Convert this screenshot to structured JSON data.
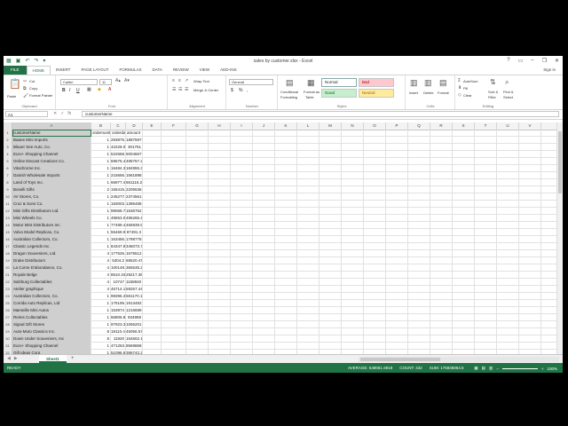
{
  "titlebar": {
    "title": "sales by customer.xlsx - Excel"
  },
  "tabs": [
    "FILE",
    "HOME",
    "INSERT",
    "PAGE LAYOUT",
    "FORMULAS",
    "DATA",
    "REVIEW",
    "VIEW",
    "ADD-INS"
  ],
  "account": {
    "signin": "Sign in"
  },
  "ribbon": {
    "clipboard": {
      "paste": "Paste",
      "cut": "Cut",
      "copy": "Copy",
      "format_painter": "Format Painter",
      "label": "Clipboard"
    },
    "font": {
      "name": "Calibri",
      "size": "11",
      "bold": "B",
      "italic": "I",
      "underline": "U",
      "label": "Font"
    },
    "alignment": {
      "wrap": "Wrap Text",
      "merge": "Merge & Center",
      "label": "Alignment"
    },
    "number": {
      "format": "General",
      "currency": "$",
      "percent": "%",
      "comma": ",",
      "label": "Number"
    },
    "styles": {
      "conditional": "Conditional",
      "conditional2": "Formatting",
      "format_as": "Format as",
      "format_as2": "Table",
      "normal": "Normal",
      "bad": "Bad",
      "good": "Good",
      "neutral": "Neutral",
      "label": "Styles"
    },
    "cells": {
      "insert": "Insert",
      "delete": "Delete",
      "format": "Format",
      "label": "Cells"
    },
    "editing": {
      "autosum": "AutoSum",
      "fill": "Fill",
      "clear": "Clear",
      "sort": "Sort &",
      "sort2": "Filter",
      "find": "Find &",
      "find2": "Select",
      "label": "Editing"
    }
  },
  "formula_bar": {
    "name_box": "A1",
    "value": "customerName"
  },
  "columns": [
    "A",
    "B",
    "C",
    "D",
    "E",
    "F",
    "G",
    "H",
    "I",
    "J",
    "K",
    "L",
    "M",
    "N",
    "O",
    "P",
    "Q",
    "R",
    "S",
    "T",
    "U",
    "V"
  ],
  "header_row": [
    "customerName",
    "ordernumber",
    "orderdate",
    "amount"
  ],
  "rows": [
    [
      "Baane Mini Imports",
      "1",
      "293875.6",
      "1887597"
    ],
    [
      "Blauer See Auto, Co.",
      "1",
      "42228.04",
      "301761"
    ],
    [
      "Euro+ Shopping Channel",
      "1",
      "522668.6",
      "5004667"
    ],
    [
      "Online Diecast Creations Co.",
      "1",
      "69675.45",
      "485757.2"
    ],
    [
      "Vitachrome Inc.",
      "1",
      "16484.34",
      "184955.3"
    ],
    [
      "Danish Wholesale Imports",
      "1",
      "215656.8",
      "1561898"
    ],
    [
      "Land of Toys Inc.",
      "1",
      "66977.46",
      "661115.2"
    ],
    [
      "Boselli Gifts",
      "2",
      "155415.6",
      "2205536"
    ],
    [
      "AV Stores, Co.",
      "1",
      "245277.1",
      "2374561"
    ],
    [
      "Cruz & Sons Co.",
      "1",
      "183003.7",
      "1395485"
    ],
    [
      "Mini Gifts Distributors Ltd.",
      "1",
      "99068.7",
      "1536752"
    ],
    [
      "Mini Wheels Co.",
      "1",
      "49653.05",
      "495265.4"
    ],
    [
      "Motor Mint Distributors Inc.",
      "1",
      "77489.42",
      "466939.5"
    ],
    [
      "Volvo Model Replicas, Co.",
      "1",
      "55469.96",
      "87491.3"
    ],
    [
      "Australian Collectors, Co.",
      "1",
      "163456.1",
      "1798776"
    ],
    [
      "Classic Legends Inc.",
      "1",
      "84347.94",
      "346073.7"
    ],
    [
      "Dragon Souveniers, Ltd.",
      "4",
      "177526.0",
      "1675512"
    ],
    [
      "Drake Distributors",
      "4",
      "5304.2",
      "68520.47"
    ],
    [
      "La Corne D'abondance, Co.",
      "4",
      "100149.4",
      "365535.2"
    ],
    [
      "Royale Belge",
      "4",
      "8510.34",
      "29217.36"
    ],
    [
      "Salzburg Collectables",
      "4",
      "10747",
      "1158840"
    ],
    [
      "Atelier graphique",
      "4",
      "45714.12",
      "59257.44"
    ],
    [
      "Australian Collectors, Co.",
      "1",
      "98396.32",
      "581170.1"
    ],
    [
      "Corrida Auto Replicas, Ltd",
      "1",
      "175195.6",
      "1913482"
    ],
    [
      "Marseille Mini Autos",
      "1",
      "153974",
      "1216689"
    ],
    [
      "Reims Collectables",
      "1",
      "66805.86",
      "934959"
    ],
    [
      "Signal Gift Stores",
      "1",
      "97923.34",
      "1065201"
    ],
    [
      "Auto-Moto Classics Inc.",
      "8",
      "18110.46",
      "45056.57"
    ],
    [
      "Down Under Souveniers, Inc",
      "8",
      "11920",
      "154602.1"
    ],
    [
      "Euro+ Shopping Channel",
      "1",
      "471263.4",
      "8569868"
    ],
    [
      "Gift Ideas Corp.",
      "1",
      "51096.97",
      "395742.2"
    ]
  ],
  "sheet": {
    "name": "Sheet1",
    "add": "+"
  },
  "status": {
    "ready": "READY",
    "average": "AVERAGE: 548061.6919",
    "count": "COUNT: 432",
    "sum": "SUM: 175836864.5",
    "zoom": "100%"
  }
}
